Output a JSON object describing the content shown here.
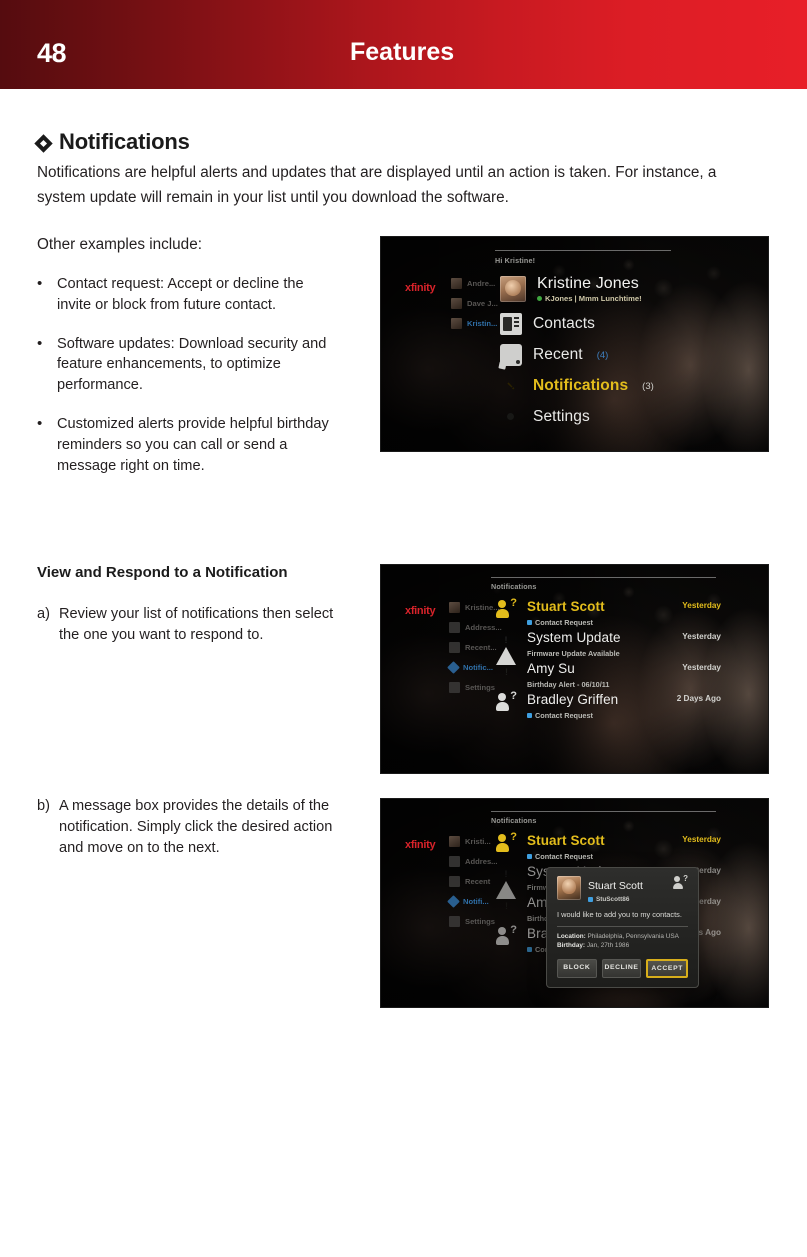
{
  "banner": {
    "page_number": "48",
    "title": "Features",
    "gradient_from": "#550c0f",
    "gradient_to": "#e81f28"
  },
  "section": {
    "heading": "Notifications",
    "heading_bullet_glyph": "diamond",
    "intro": "Notifications are helpful alerts and updates that are displayed until an action is taken. For instance, a system update will remain in your list until you download the software.",
    "other_examples_label": "Other examples include:",
    "bullets": [
      {
        "marker": "•",
        "text": "Contact request: Accept or decline the invite or block from future contact."
      },
      {
        "marker": "•",
        "text": "Software updates: Download security and feature enhancements, to optimize performance."
      },
      {
        "marker": "•",
        "text": "Customized alerts provide helpful birthday reminders so you can call or send a message right on time."
      }
    ]
  },
  "procedure": {
    "title": "View and Respond to a Notification",
    "steps": [
      {
        "marker": "a)",
        "text": "Review your list of notifications then select the one you want to respond to."
      },
      {
        "marker": "b)",
        "text": "A message box provides the details of the notification. Simply click the desired action and move on to the next."
      }
    ]
  },
  "screenshot_1": {
    "brand": "xfinity",
    "breadcrumb": "Hi Kristine!",
    "background_nav": [
      {
        "label": "Andre...",
        "icon": "avatar-icon",
        "selected": false
      },
      {
        "label": "Dave J...",
        "icon": "avatar-icon",
        "selected": false
      },
      {
        "label": "Kristin...",
        "icon": "avatar-icon",
        "selected": true
      }
    ],
    "profile": {
      "name": "Kristine Jones",
      "handle": "KJones | Mmm Lunchtime!",
      "status_color": "#3fa63f"
    },
    "menu": [
      {
        "label": "Contacts",
        "icon": "contacts-icon",
        "count": "",
        "active": false
      },
      {
        "label": "Recent",
        "icon": "recent-icon",
        "count": "(4)",
        "active": false
      },
      {
        "label": "Notifications",
        "icon": "notifications-diamond-icon",
        "count": "(3)",
        "active": true
      },
      {
        "label": "Settings",
        "icon": "gear-icon",
        "count": "",
        "active": false
      }
    ],
    "accent_color": "#e3bd1c",
    "count_color": "#3f7fbf"
  },
  "screenshot_2": {
    "brand": "xfinity",
    "breadcrumb": "Notifications",
    "background_nav": [
      {
        "label": "Kristine...",
        "icon": "avatar-icon",
        "selected": false
      },
      {
        "label": "Address...",
        "icon": "contacts-icon",
        "selected": false
      },
      {
        "label": "Recent...",
        "icon": "recent-icon",
        "selected": false
      },
      {
        "label": "Notific...",
        "icon": "notifications-diamond-icon",
        "selected": true
      },
      {
        "label": "Settings",
        "icon": "gear-icon",
        "selected": false
      }
    ],
    "notifications": [
      {
        "name": "Stuart Scott",
        "subtitle": "Contact Request",
        "time": "Yesterday",
        "icon": "person-question-icon",
        "highlighted": true
      },
      {
        "name": "System Update",
        "subtitle": "Firmware Update Available",
        "time": "Yesterday",
        "icon": "warning-triangle-icon",
        "highlighted": false
      },
      {
        "name": "Amy Su",
        "subtitle": "Birthday Alert - 06/10/11",
        "time": "Yesterday",
        "icon": "alert-gear-icon",
        "highlighted": false
      },
      {
        "name": "Bradley Griffen",
        "subtitle": "Contact Request",
        "time": "2 Days Ago",
        "icon": "person-question-icon",
        "highlighted": false
      }
    ],
    "accent_color": "#e3bd1c"
  },
  "screenshot_3": {
    "brand": "xfinity",
    "breadcrumb": "Notifications",
    "background_nav": [
      {
        "label": "Kristi...",
        "icon": "avatar-icon",
        "selected": false
      },
      {
        "label": "Addres...",
        "icon": "contacts-icon",
        "selected": false
      },
      {
        "label": "Recent",
        "icon": "recent-icon",
        "selected": false
      },
      {
        "label": "Notifi...",
        "icon": "notifications-diamond-icon",
        "selected": true
      },
      {
        "label": "Settings",
        "icon": "gear-icon",
        "selected": false
      }
    ],
    "notifications": [
      {
        "name": "Stuart Scott",
        "subtitle": "Contact Request",
        "time": "Yesterday",
        "icon": "person-question-icon",
        "highlighted": true
      },
      {
        "name": "System Update",
        "subtitle": "Firmware Update Available",
        "time": "Yesterday",
        "icon": "warning-triangle-icon",
        "highlighted": false
      },
      {
        "name": "Amy Su",
        "subtitle": "Birthday Alert",
        "time": "Yesterday",
        "icon": "alert-gear-icon",
        "highlighted": false
      },
      {
        "name": "Bradley Griffen",
        "subtitle": "Contact Request",
        "time": "2 Days Ago",
        "icon": "person-question-icon",
        "highlighted": false
      }
    ],
    "dialog": {
      "name": "Stuart Scott",
      "handle": "StuScott86",
      "message": "I would like to add you to my contacts.",
      "location_label": "Location:",
      "location_value": "Philadelphia, Pennsylvania USA",
      "birthday_label": "Birthday:",
      "birthday_value": "Jan, 27th 1986",
      "buttons": [
        {
          "label": "BLOCK",
          "focused": false
        },
        {
          "label": "DECLINE",
          "focused": false
        },
        {
          "label": "ACCEPT",
          "focused": true
        }
      ],
      "focus_color": "#d7ae1b",
      "person_icon": "person-question-icon"
    }
  }
}
